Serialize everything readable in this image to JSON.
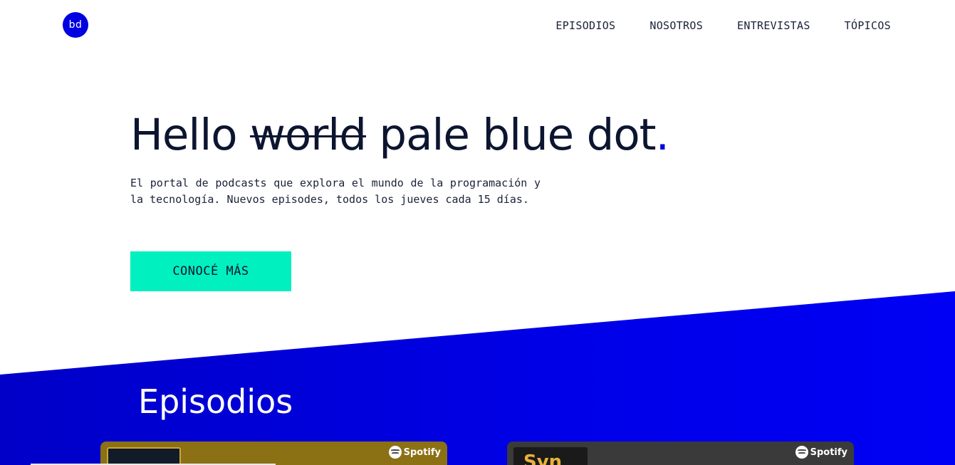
{
  "header": {
    "logo_text": "bd",
    "nav": [
      {
        "label": "EPISODIOS"
      },
      {
        "label": "NOSOTROS"
      },
      {
        "label": "ENTREVISTAS"
      },
      {
        "label": "TÓPICOS"
      }
    ]
  },
  "hero": {
    "title_start": "Hello ",
    "title_struck": "world",
    "title_end": " pale blue dot",
    "title_dot": ".",
    "description": "El portal de podcasts que explora el mundo de la programación y la tecnología. Nuevos episodes, todos los jueves cada 15 días.",
    "cta_label": "CONOCÉ MÁS"
  },
  "episodes": {
    "title": "Episodios",
    "cards": [
      {
        "provider": "Spotify",
        "thumb_text": ""
      },
      {
        "provider": "Spotify",
        "thumb_text": "Syn"
      }
    ]
  },
  "colors": {
    "accent_blue": "#0000e0",
    "cta_green": "#00f0c0",
    "card1_bg": "#8b7014",
    "card2_bg": "#3a3a3a"
  }
}
